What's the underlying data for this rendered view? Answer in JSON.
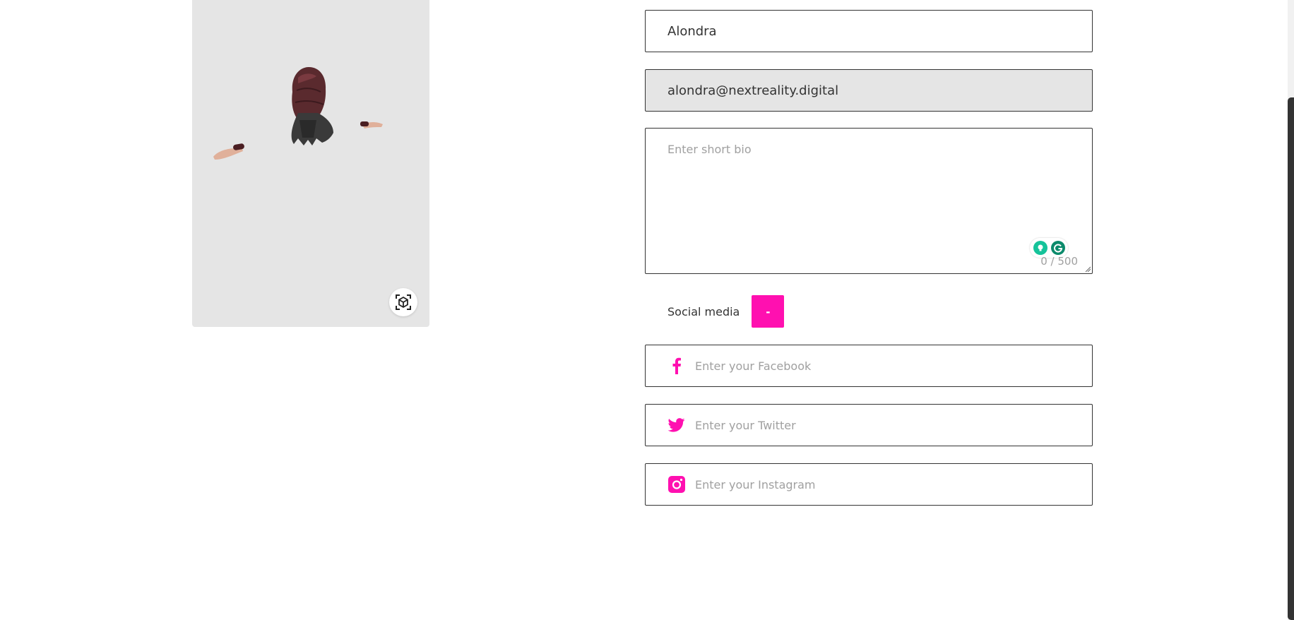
{
  "avatar": {
    "ar_icon": "ar-cube-scan-icon"
  },
  "profile": {
    "name_value": "Alondra",
    "email_value": "alondra@nextreality.digital",
    "bio_placeholder": "Enter short bio",
    "bio_counter": "0 / 500"
  },
  "social": {
    "label": "Social media",
    "toggle_label": "-",
    "facebook": {
      "icon": "facebook-icon",
      "placeholder": "Enter your Facebook"
    },
    "twitter": {
      "icon": "twitter-icon",
      "placeholder": "Enter your Twitter"
    },
    "instagram": {
      "icon": "instagram-icon",
      "placeholder": "Enter your Instagram"
    }
  },
  "colors": {
    "accent": "#ff10b0",
    "panel_bg": "#e5e5e5",
    "border": "#333333"
  }
}
